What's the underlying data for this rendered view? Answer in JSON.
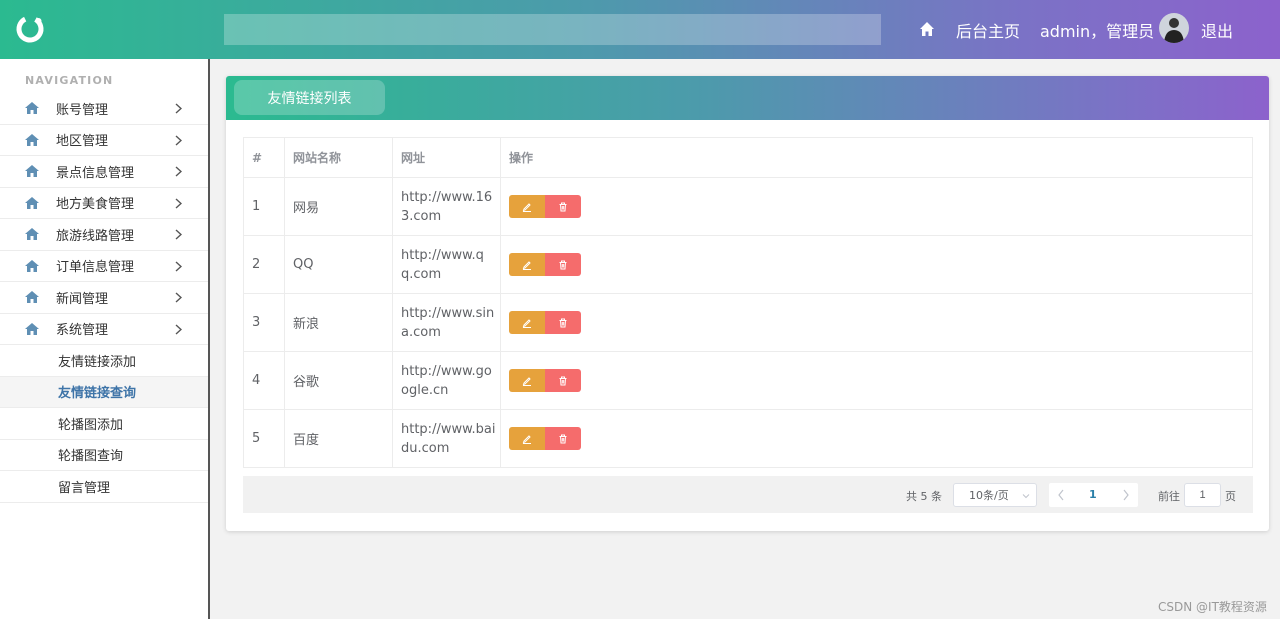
{
  "header": {
    "home_label": "后台主页",
    "user_label": "admin，管理员",
    "logout_label": "退出",
    "search_value": ""
  },
  "sidebar": {
    "nav_title": "NAVIGATION",
    "items": [
      {
        "label": "账号管理"
      },
      {
        "label": "地区管理"
      },
      {
        "label": "景点信息管理"
      },
      {
        "label": "地方美食管理"
      },
      {
        "label": "旅游线路管理"
      },
      {
        "label": "订单信息管理"
      },
      {
        "label": "新闻管理"
      },
      {
        "label": "系统管理"
      }
    ],
    "sub_items": [
      {
        "label": "友情链接添加"
      },
      {
        "label": "友情链接查询"
      },
      {
        "label": "轮播图添加"
      },
      {
        "label": "轮播图查询"
      },
      {
        "label": "留言管理"
      }
    ]
  },
  "panel": {
    "tab_label": "友情链接列表"
  },
  "table": {
    "headers": [
      "#",
      "网站名称",
      "网址",
      "操作"
    ],
    "rows": [
      {
        "id": "1",
        "name": "网易",
        "url": "http://www.163.com"
      },
      {
        "id": "2",
        "name": "QQ",
        "url": "http://www.qq.com"
      },
      {
        "id": "3",
        "name": "新浪",
        "url": "http://www.sina.com"
      },
      {
        "id": "4",
        "name": "谷歌",
        "url": "http://www.google.cn"
      },
      {
        "id": "5",
        "name": "百度",
        "url": "http://www.baidu.com"
      }
    ]
  },
  "pagination": {
    "total": "共 5 条",
    "page_size": "10条/页",
    "current_page": "1",
    "goto_label": "前往",
    "goto_value": "1",
    "page_suffix": "页"
  },
  "watermark": "CSDN @IT教程资源",
  "colors": {
    "edit": "#e6a23c",
    "delete": "#f56c6c",
    "accent_start": "#2bba90",
    "accent_end": "#8c62cc"
  }
}
